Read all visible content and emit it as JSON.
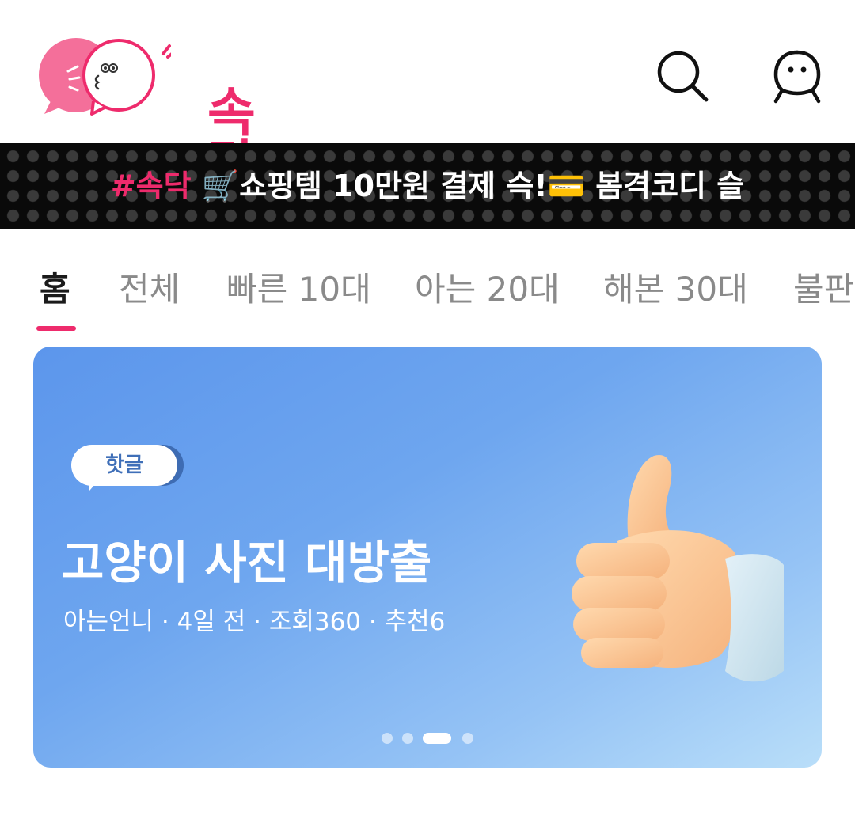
{
  "header": {
    "logo_text": "속닥",
    "search_icon": "search-icon",
    "profile_icon": "profile-icon"
  },
  "ticker": {
    "tag": "#속닥",
    "text_part1": " 🛒쇼핑템 10만원 결제 슥!",
    "text_part2": "💳 봄격코디 슬"
  },
  "tabs": [
    {
      "label": "홈",
      "active": true
    },
    {
      "label": "전체",
      "active": false
    },
    {
      "label": "빠른 10대",
      "active": false
    },
    {
      "label": "아는 20대",
      "active": false
    },
    {
      "label": "해본 30대",
      "active": false
    },
    {
      "label": "불판",
      "active": false
    }
  ],
  "banner": {
    "badge": "핫글",
    "title": "고양이 사진 대방출",
    "meta": "아는언니 · 4일 전 · 조회360 · 추천6",
    "page_count": 4,
    "active_page": 3
  },
  "colors": {
    "brand": "#ee2b6c",
    "ticker_bg": "#0a0a0a",
    "banner_start": "#5c96ec",
    "banner_end": "#b9def9"
  }
}
